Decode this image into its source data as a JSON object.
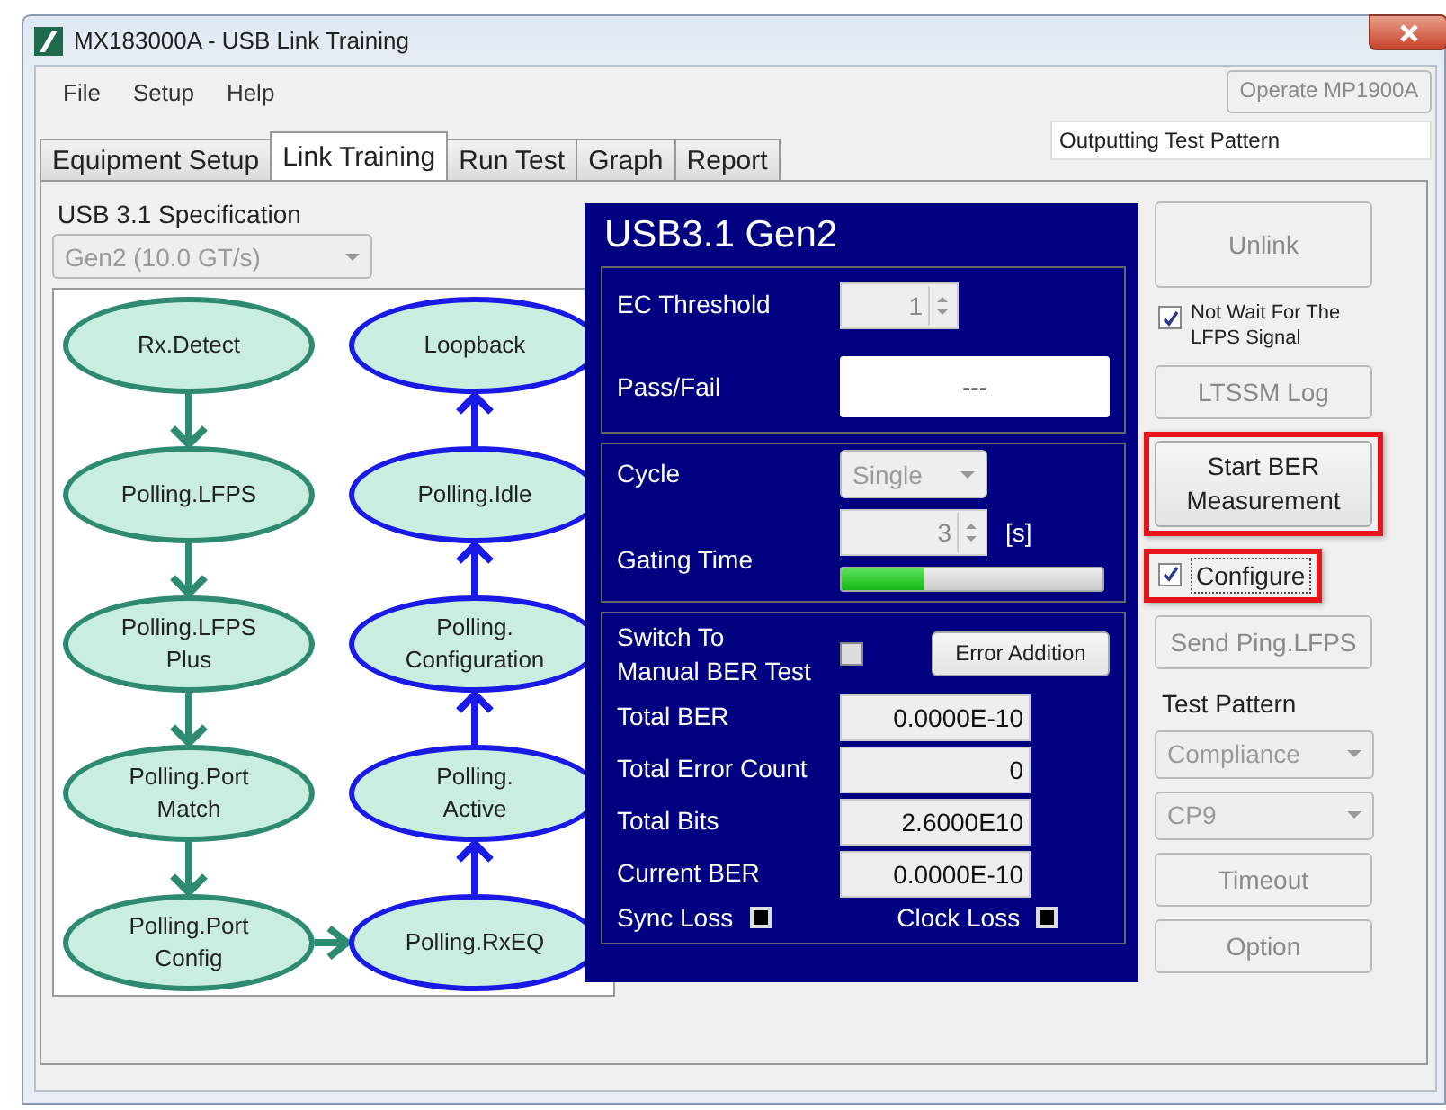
{
  "window": {
    "title": "MX183000A - USB Link Training"
  },
  "menu": [
    "File",
    "Setup",
    "Help"
  ],
  "operate_button": {
    "label": "Operate MP1900A",
    "disabled": true
  },
  "tabs": [
    {
      "label": "Equipment Setup",
      "selected": false
    },
    {
      "label": "Link Training",
      "selected": true
    },
    {
      "label": "Run Test",
      "selected": false
    },
    {
      "label": "Graph",
      "selected": false
    },
    {
      "label": "Report",
      "selected": false
    }
  ],
  "status_field": {
    "value": "Outputting Test Pattern"
  },
  "specification": {
    "label": "USB 3.1 Specification",
    "value": "Gen2 (10.0 GT/s)",
    "disabled": true
  },
  "diagram": {
    "chains": [
      {
        "color": "#2e8b72",
        "nodes": [
          "Rx.Detect",
          "Polling.LFPS",
          "Polling.LFPS\nPlus",
          "Polling.Port\nMatch",
          "Polling.Port\nConfig"
        ]
      },
      {
        "color": "#1a1ae6",
        "nodes": [
          "Loopback",
          "Polling.Idle",
          "Polling.\nConfiguration",
          "Polling.\nActive",
          "Polling.RxEQ"
        ]
      }
    ]
  },
  "ber_panel": {
    "title": "USB3.1 Gen2",
    "ec_threshold": {
      "label": "EC Threshold",
      "value": "1",
      "disabled": true
    },
    "pass_fail": {
      "label": "Pass/Fail",
      "value": "---"
    },
    "cycle": {
      "label": "Cycle",
      "value": "Single",
      "disabled": true
    },
    "gating_time": {
      "label": "Gating Time",
      "value": "3",
      "unit": "[s]",
      "disabled": true,
      "level": 0.32
    },
    "manual": {
      "label": "Switch To\nManual BER Test",
      "checked": false
    },
    "error_addition": {
      "label": "Error Addition"
    },
    "results": [
      {
        "label": "Total BER",
        "value": "0.0000E-10"
      },
      {
        "label": "Total Error Count",
        "value": "0"
      },
      {
        "label": "Total Bits",
        "value": "2.6000E10"
      },
      {
        "label": "Current BER",
        "value": "0.0000E-10"
      }
    ],
    "indicators": [
      {
        "label": "Sync Loss",
        "on": false
      },
      {
        "label": "Clock Loss",
        "on": false
      }
    ]
  },
  "side": [
    {
      "kind": "large_button",
      "label": "Unlink",
      "disabled": true,
      "highlighted": false
    },
    {
      "kind": "checkbox",
      "label": "Not Wait For The\nLFPS Signal",
      "checked": true,
      "highlighted": false
    },
    {
      "kind": "button",
      "label": "LTSSM Log",
      "disabled": true,
      "highlighted": false
    },
    {
      "kind": "large_button",
      "label": "Start BER\nMeasurement",
      "disabled": false,
      "highlighted": true
    },
    {
      "kind": "checkbox",
      "label": "Configure",
      "checked": true,
      "highlighted": true
    },
    {
      "kind": "button",
      "label": "Send Ping.LFPS",
      "disabled": true,
      "highlighted": false
    },
    {
      "kind": "label",
      "label": "Test Pattern"
    },
    {
      "kind": "dropdown",
      "value": "Compliance",
      "disabled": true
    },
    {
      "kind": "dropdown",
      "value": "CP9",
      "disabled": true
    },
    {
      "kind": "button",
      "label": "Timeout",
      "disabled": true,
      "highlighted": false
    },
    {
      "kind": "button",
      "label": "Option",
      "disabled": true,
      "highlighted": false
    }
  ]
}
